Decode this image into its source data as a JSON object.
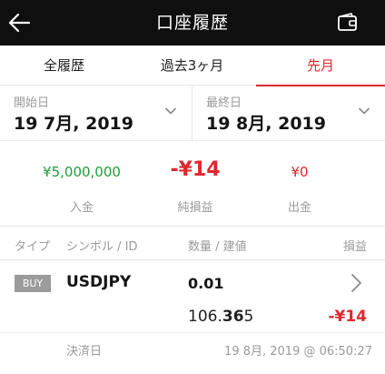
{
  "header": {
    "title": "口座履歴",
    "back_icon": "arrow-left-icon",
    "wallet_icon": "wallet-icon"
  },
  "tabs": [
    {
      "label": "全履歴",
      "active": false
    },
    {
      "label": "過去3ヶ月",
      "active": false
    },
    {
      "label": "先月",
      "active": true
    }
  ],
  "colors": {
    "accent": "#e0282f",
    "positive": "#1f9e3a",
    "header_bg": "#0f0f0f"
  },
  "date_range": {
    "start": {
      "label": "開始日",
      "value": "19 7月, 2019"
    },
    "end": {
      "label": "最終日",
      "value": "19 8月, 2019"
    }
  },
  "summary": {
    "deposit": {
      "value": "¥5,000,000",
      "label": "入金"
    },
    "net": {
      "value": "-¥14",
      "label": "純損益"
    },
    "withdrawal": {
      "value": "¥0",
      "label": "出金"
    }
  },
  "columns": {
    "type": "タイプ",
    "symbol": "シンボル / ID",
    "qty": "数量 / 建値",
    "pl": "損益"
  },
  "trade": {
    "type": "BUY",
    "symbol": "USDJPY",
    "qty": "0.01",
    "price_prefix": "106.",
    "price_bold": "36",
    "price_suffix": "5",
    "pl": "-¥14",
    "settle_label": "決済日",
    "settle_value": "19 8月, 2019 @ 06:50:27"
  }
}
